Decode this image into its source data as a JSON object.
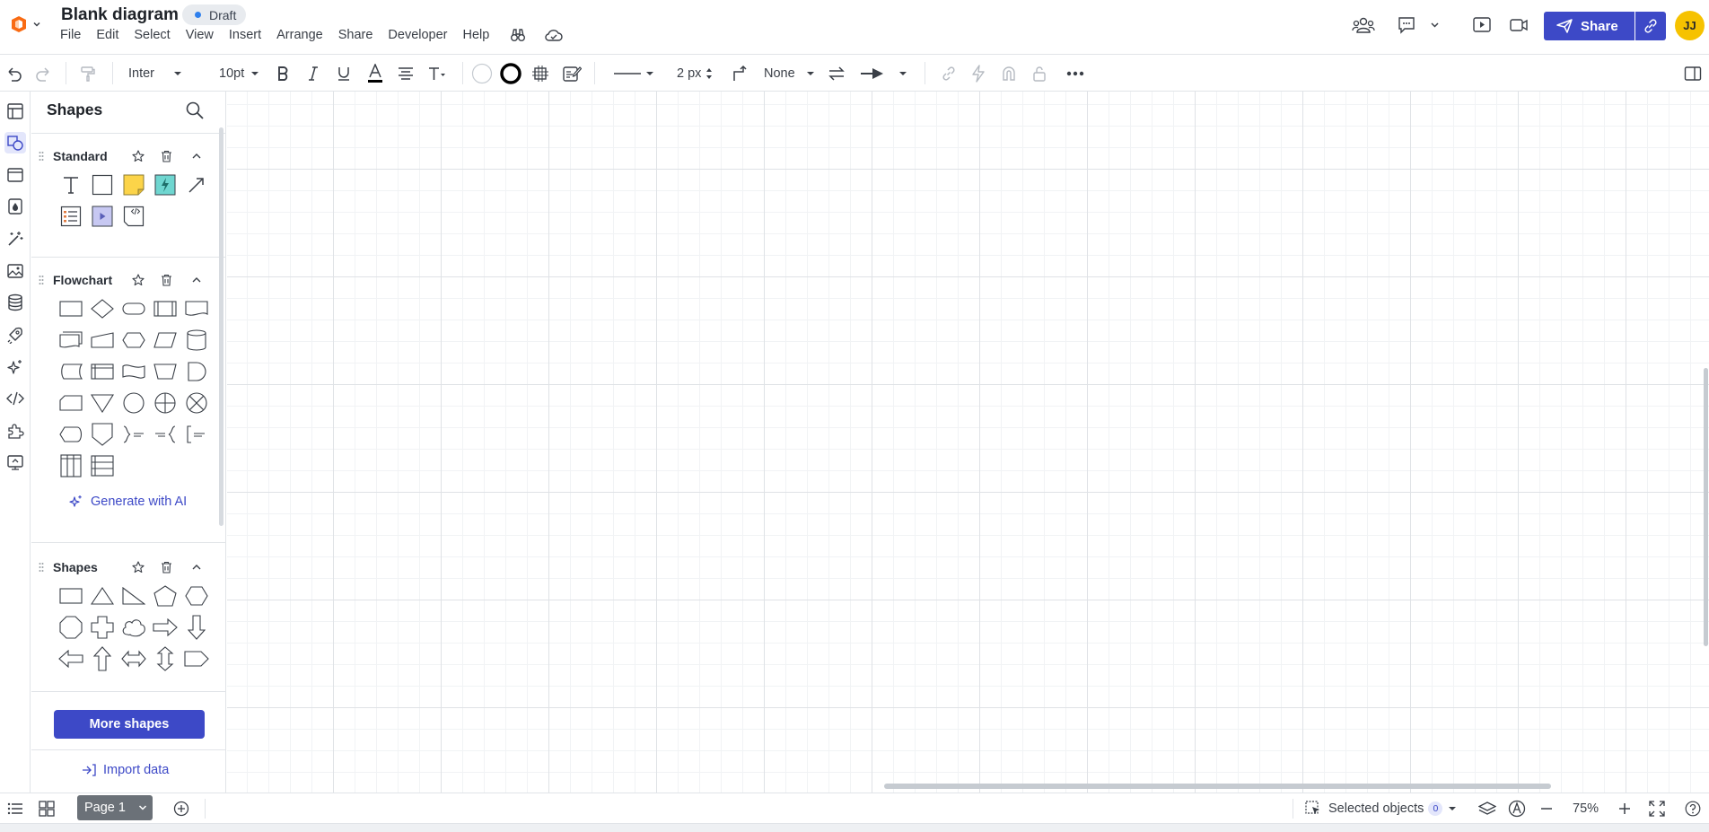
{
  "app": {
    "document_title": "Blank diagram",
    "status_badge": "Draft",
    "menu": [
      "File",
      "Edit",
      "Select",
      "View",
      "Insert",
      "Arrange",
      "Share",
      "Developer",
      "Help"
    ],
    "share_label": "Share",
    "user_initials": "JJ",
    "brand_color": "#3d49c7"
  },
  "toolbar": {
    "font_family": "Inter",
    "font_size": "10pt",
    "line_width": "2 px",
    "line_end": "None"
  },
  "shapes_panel": {
    "title": "Shapes",
    "sections": [
      {
        "label": "Standard"
      },
      {
        "label": "Flowchart"
      },
      {
        "label": "Shapes"
      }
    ],
    "generate_ai_label": "Generate with AI",
    "more_shapes_label": "More shapes",
    "import_data_label": "Import data"
  },
  "bottom_bar": {
    "page_tab": "Page 1",
    "selected_objects_label": "Selected objects",
    "selected_count": "0",
    "zoom": "75%"
  }
}
